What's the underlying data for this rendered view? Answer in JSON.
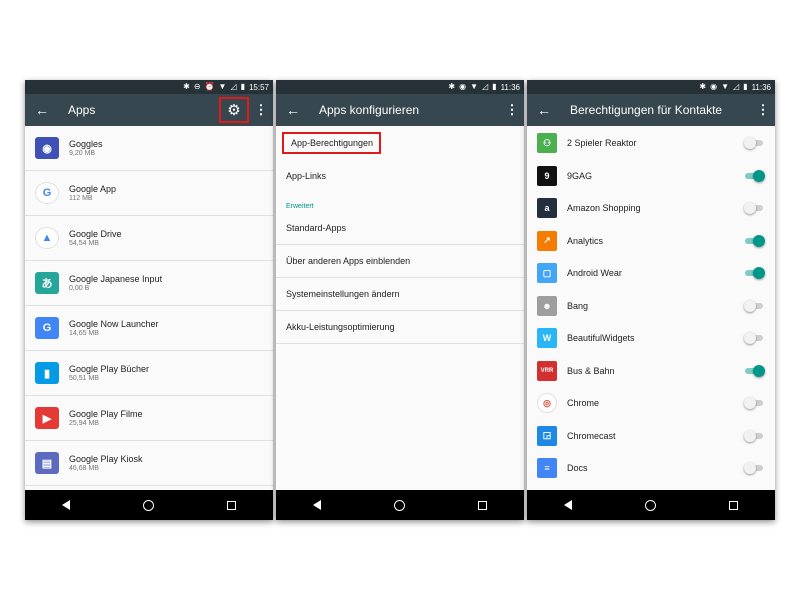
{
  "panel1": {
    "status_time": "15:57",
    "title": "Apps",
    "apps": [
      {
        "name": "Goggles",
        "size": "9,20 MB",
        "icon": "goggles-icon",
        "color": "#3f51b5",
        "glyph": "◉"
      },
      {
        "name": "Google App",
        "size": "112 MB",
        "icon": "google-g-icon",
        "color": "#ffffff",
        "glyph": "G"
      },
      {
        "name": "Google Drive",
        "size": "54,54 MB",
        "icon": "drive-icon",
        "color": "#ffffff",
        "glyph": "▲"
      },
      {
        "name": "Google Japanese Input",
        "size": "0,00 B",
        "icon": "japanese-input-icon",
        "color": "#26a69a",
        "glyph": "あ"
      },
      {
        "name": "Google Now Launcher",
        "size": "14,65 MB",
        "icon": "google-now-icon",
        "color": "#4285f4",
        "glyph": "G"
      },
      {
        "name": "Google Play Bücher",
        "size": "50,51 MB",
        "icon": "play-books-icon",
        "color": "#039be5",
        "glyph": "▮"
      },
      {
        "name": "Google Play Filme",
        "size": "25,94 MB",
        "icon": "play-movies-icon",
        "color": "#e53935",
        "glyph": "▶"
      },
      {
        "name": "Google Play Kiosk",
        "size": "46,68 MB",
        "icon": "play-kiosk-icon",
        "color": "#5c6bc0",
        "glyph": "▤"
      }
    ]
  },
  "panel2": {
    "status_time": "11:36",
    "title": "Apps konfigurieren",
    "items_top": [
      "App-Berechtigungen",
      "App-Links"
    ],
    "section": "Erweitert",
    "items_bottom": [
      "Standard-Apps",
      "Über anderen Apps einblenden",
      "Systemeinstellungen ändern",
      "Akku-Leistungsoptimierung"
    ]
  },
  "panel3": {
    "status_time": "11:36",
    "title": "Berechtigungen für Kontakte",
    "apps": [
      {
        "name": "2 Spieler Reaktor",
        "on": false,
        "icon": "reaktor-icon",
        "color": "#4caf50",
        "glyph": "⚇"
      },
      {
        "name": "9GAG",
        "on": true,
        "icon": "9gag-icon",
        "color": "#111111",
        "glyph": "9"
      },
      {
        "name": "Amazon Shopping",
        "on": false,
        "icon": "amazon-icon",
        "color": "#232f3e",
        "glyph": "a"
      },
      {
        "name": "Analytics",
        "on": true,
        "icon": "analytics-icon",
        "color": "#f57c00",
        "glyph": "↗"
      },
      {
        "name": "Android Wear",
        "on": true,
        "icon": "android-wear-icon",
        "color": "#42a5f5",
        "glyph": "▢"
      },
      {
        "name": "Bang",
        "on": false,
        "icon": "bang-icon",
        "color": "#9e9e9e",
        "glyph": "☻"
      },
      {
        "name": "BeautifulWidgets",
        "on": false,
        "icon": "beautiful-widgets-icon",
        "color": "#29b6f6",
        "glyph": "W"
      },
      {
        "name": "Bus & Bahn",
        "on": true,
        "icon": "bus-bahn-icon",
        "color": "#d32f2f",
        "glyph": "VRR"
      },
      {
        "name": "Chrome",
        "on": false,
        "icon": "chrome-icon",
        "color": "#ffffff",
        "glyph": "◎"
      },
      {
        "name": "Chromecast",
        "on": false,
        "icon": "chromecast-icon",
        "color": "#1e88e5",
        "glyph": "◲"
      },
      {
        "name": "Docs",
        "on": false,
        "icon": "docs-icon",
        "color": "#4285f4",
        "glyph": "≡"
      }
    ]
  },
  "colors": {
    "appbar": "#37474f",
    "status": "#263238",
    "accent": "#009688",
    "highlight": "#e0191b"
  }
}
